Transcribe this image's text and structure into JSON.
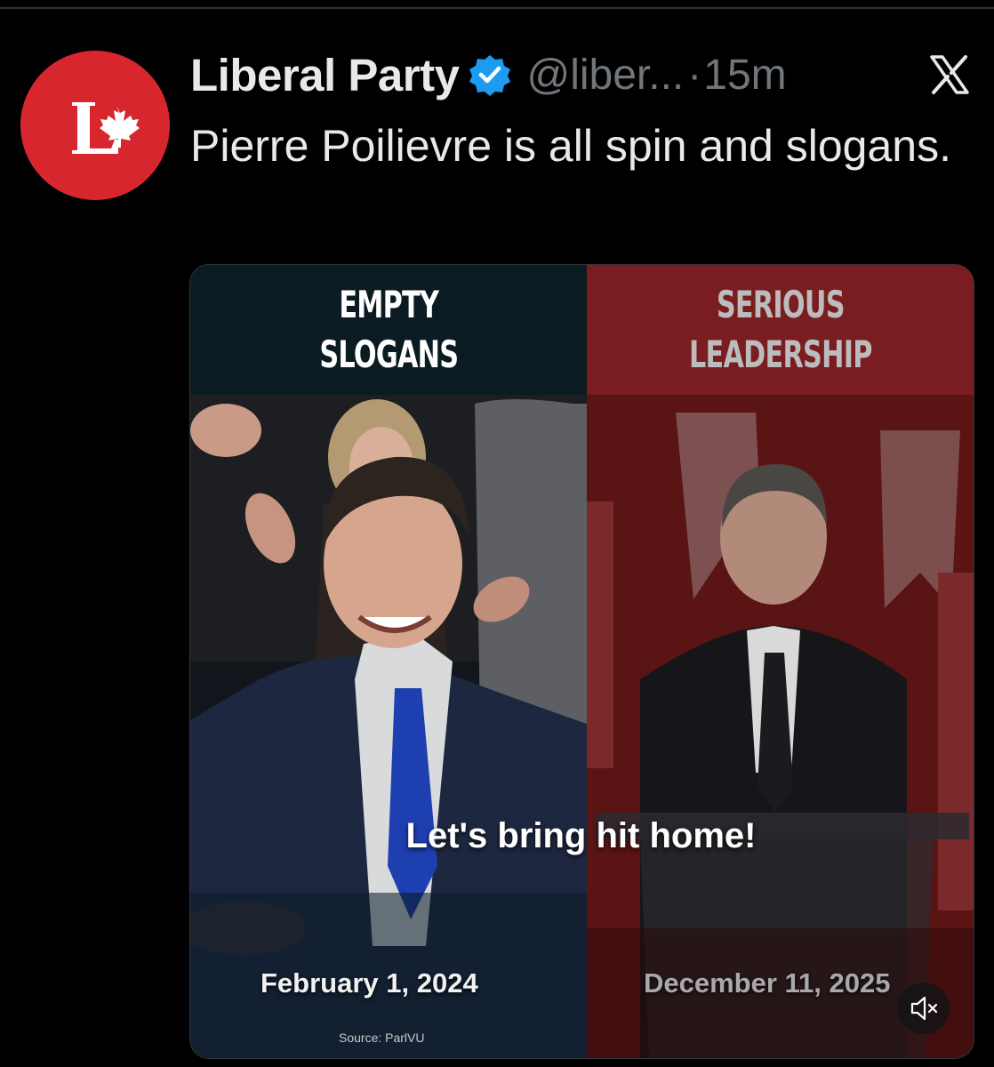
{
  "post": {
    "author": "Liberal Party",
    "handle": "@liber...",
    "separator": "·",
    "time": "15m",
    "text": "Pierre Poilievre is all spin and slogans."
  },
  "avatar": {
    "icon": "liberal-logo-icon",
    "letter": "L",
    "color": "#d7262e"
  },
  "icons": {
    "verified": "verified-badge-icon",
    "platform": "x-logo-icon",
    "mute": "speaker-muted-icon"
  },
  "media": {
    "left": {
      "title_line1": "EMPTY",
      "title_line2": "SLOGANS",
      "date": "February 1, 2024"
    },
    "right": {
      "title_line1": "SERIOUS",
      "title_line2": "LEADERSHIP",
      "date": "December 11, 2025"
    },
    "caption": "Let's bring hit home!",
    "source": "Source: ParlVU"
  },
  "colors": {
    "verified": "#1d9bf0",
    "secondary_text": "#71767b",
    "band_left": "#0b1b22",
    "band_right": "#7a1d20"
  }
}
